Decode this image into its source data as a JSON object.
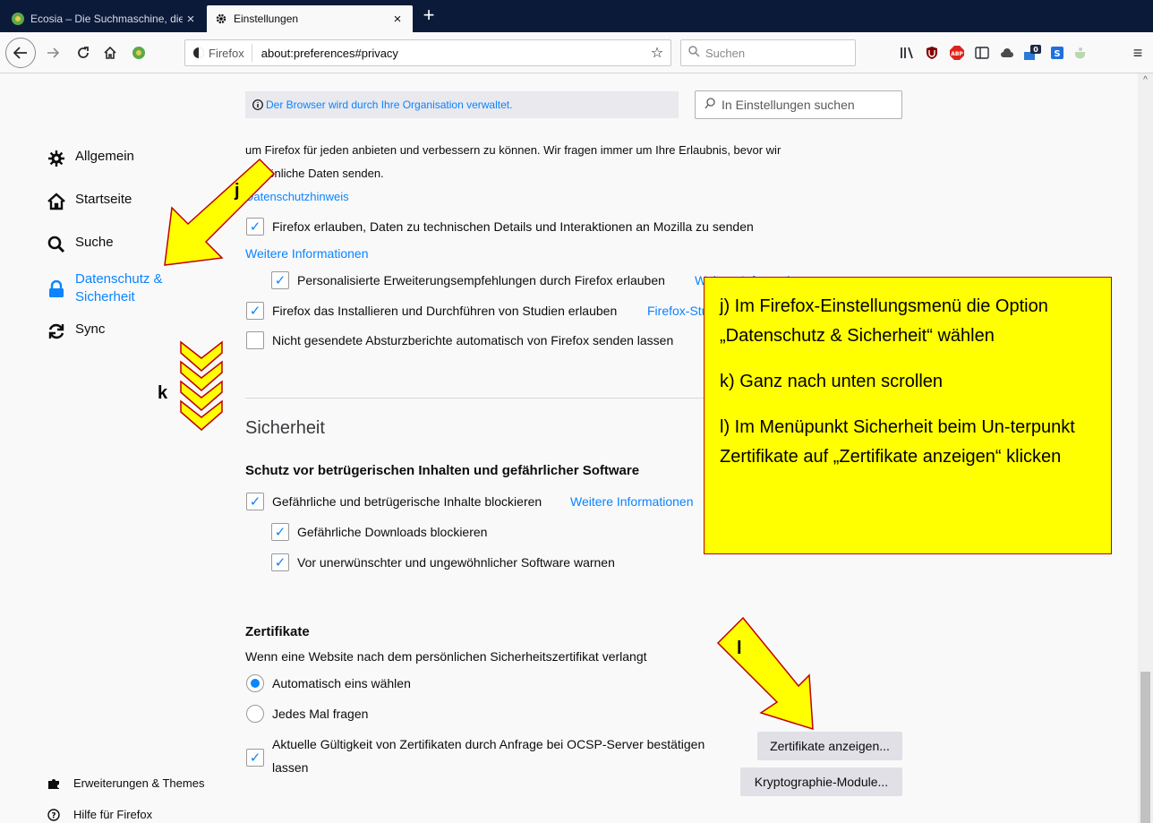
{
  "tabs": [
    {
      "label": "Ecosia – Die Suchmaschine, die",
      "close": "×"
    },
    {
      "label": "Einstellungen",
      "close": "×"
    }
  ],
  "new_tab": "+",
  "navbar": {
    "identity": "Firefox",
    "url": "about:preferences#privacy",
    "search_placeholder": "Suchen",
    "badge_count": "0"
  },
  "managed_notice": "Der Browser wird durch Ihre Organisation verwaltet.",
  "prefs_search_placeholder": "In Einstellungen suchen",
  "categories": [
    {
      "label": "Allgemein",
      "icon": "gear-icon"
    },
    {
      "label": "Startseite",
      "icon": "home-icon"
    },
    {
      "label": "Suche",
      "icon": "search-icon"
    },
    {
      "label": "Datenschutz & Sicherheit",
      "icon": "lock-icon"
    },
    {
      "label": "Sync",
      "icon": "sync-icon"
    }
  ],
  "footer": [
    {
      "label": "Erweiterungen & Themes",
      "icon": "puzzle-icon"
    },
    {
      "label": "Hilfe für Firefox",
      "icon": "help-icon"
    }
  ],
  "data_collection": {
    "intro_line1": "um Firefox für jeden anbieten und verbessern zu können. Wir fragen immer um Ihre Erlaubnis, bevor wir",
    "intro_line2": "persönliche Daten senden.",
    "privacy_link": "Datenschutzhinweis",
    "technical_data": "Firefox erlauben, Daten zu technischen Details und Interaktionen an Mozilla zu senden",
    "more_info": "Weitere Informationen",
    "personalized": "Personalisierte Erweiterungsempfehlungen durch Firefox erlauben",
    "personalized_link": "Weitere Informationen",
    "studies": "Firefox das Installieren und Durchführen von Studien erlauben",
    "studies_link": "Firefox-Studien ansehen",
    "crash_reports": "Nicht gesendete Absturzberichte automatisch von Firefox senden lassen"
  },
  "security": {
    "heading": "Sicherheit",
    "subheading": "Schutz vor betrügerischen Inhalten und gefährlicher Software",
    "block_dangerous": "Gefährliche und betrügerische Inhalte blockieren",
    "block_link": "Weitere Informationen",
    "block_downloads": "Gefährliche Downloads blockieren",
    "warn_software": "Vor unerwünschter und ungewöhnlicher Software warnen"
  },
  "certificates": {
    "heading": "Zertifikate",
    "description": "Wenn eine Website nach dem persönlichen Sicherheitszertifikat verlangt",
    "auto_select": "Automatisch eins wählen",
    "ask_every_time": "Jedes Mal fragen",
    "ocsp_line1": "Aktuelle Gültigkeit von Zertifikaten durch Anfrage bei OCSP-Server bestätigen",
    "ocsp_line2": "lassen",
    "view_certificates": "Zertifikate anzeigen...",
    "security_devices": "Kryptographie-Module..."
  },
  "annotation": {
    "step_j": "j) Im Firefox-Einstellungsmenü die Option „Datenschutz & Sicherheit“ wählen",
    "step_k": "k) Ganz nach unten scrollen",
    "step_l": "l) Im Menüpunkt Sicherheit beim Un-terpunkt Zertifikate auf „Zertifikate anzeigen“ klicken",
    "label_j": "j",
    "label_k": "k",
    "label_l": "l",
    "highlight_color": "#ffff00",
    "border_color": "#c00000"
  }
}
